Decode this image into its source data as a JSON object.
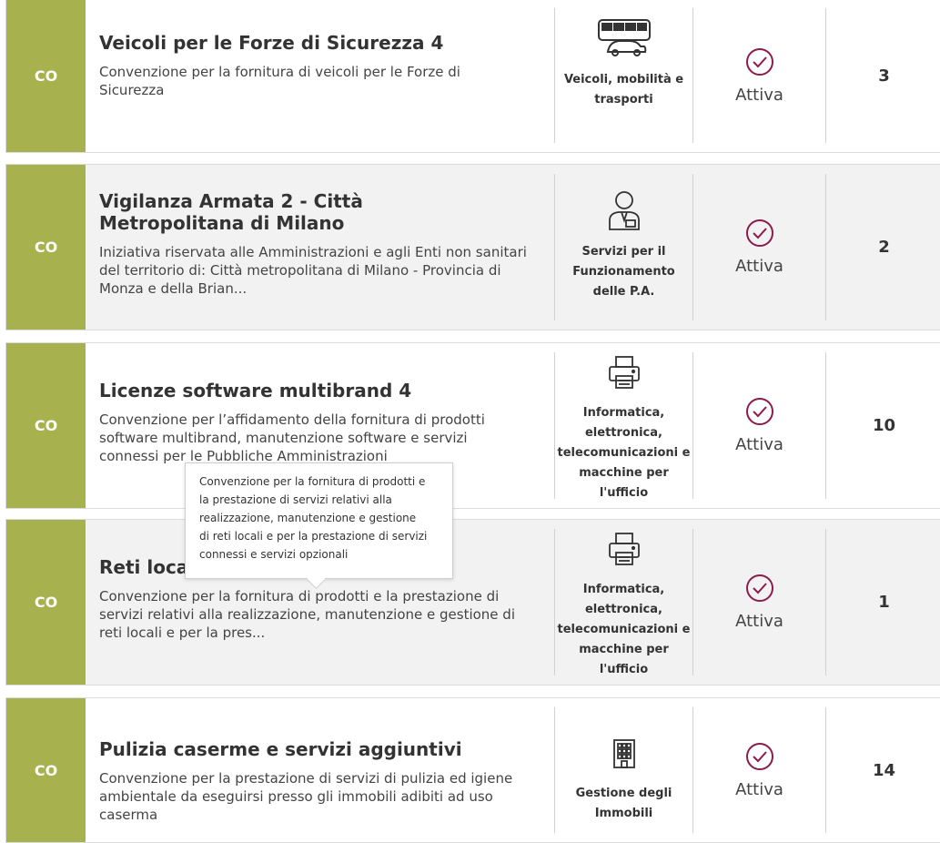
{
  "rows": [
    {
      "badge": "CO",
      "title": "Veicoli per le Forze di Sicurezza 4",
      "description": "Convenzione per la fornitura di veicoli per le Forze di Sicurezza",
      "category_icon": "vehicles-icon",
      "category_lines": [
        "Veicoli, mobilità e",
        "trasporti"
      ],
      "status": "Attiva",
      "count": "3"
    },
    {
      "badge": "CO",
      "title": "Vigilanza Armata 2 - Città Metropolitana di Milano",
      "description": "Iniziativa riservata alle Amministrazioni e agli Enti non sanitari del territorio di: Città metropolitana di Milano - Provincia di Monza e della Brian...",
      "category_icon": "person-services-icon",
      "category_lines": [
        "Servizi per il",
        "Funzionamento",
        "delle P.A."
      ],
      "status": "Attiva",
      "count": "2"
    },
    {
      "badge": "CO",
      "title": "Licenze software multibrand 4",
      "description": "Convenzione per l’affidamento della fornitura di prodotti software multibrand, manutenzione software e servizi connessi per le Pubbliche Amministrazioni",
      "category_icon": "printer-icon",
      "category_lines": [
        "Informatica,",
        "elettronica,",
        "telecomunicazioni e",
        "macchine per",
        "l'ufficio"
      ],
      "status": "Attiva",
      "count": "10"
    },
    {
      "badge": "CO",
      "title": "Reti locali 7",
      "description": "Convenzione per la fornitura di prodotti e la prestazione di servizi relativi alla realizzazione, manutenzione e gestione di reti locali e per la pres...",
      "category_icon": "printer-icon",
      "category_lines": [
        "Informatica,",
        "elettronica,",
        "telecomunicazioni e",
        "macchine per",
        "l'ufficio"
      ],
      "status": "Attiva",
      "count": "1"
    },
    {
      "badge": "CO",
      "title": "Pulizia caserme e servizi aggiuntivi",
      "description": "Convenzione per la prestazione di servizi di pulizia ed igiene ambientale da eseguirsi presso gli immobili adibiti ad uso caserma",
      "category_icon": "building-icon",
      "category_lines": [
        "Gestione degli",
        "Immobili"
      ],
      "status": "Attiva",
      "count": "14"
    }
  ],
  "tooltip": {
    "lines": [
      "Convenzione per la fornitura di prodotti e",
      "la prestazione di servizi relativi alla",
      "realizzazione, manutenzione e gestione",
      "di reti locali e per la prestazione di servizi",
      "connessi e servizi opzionali"
    ]
  },
  "colors": {
    "badge": "#a7b24f",
    "status_icon": "#8b1d4a"
  }
}
